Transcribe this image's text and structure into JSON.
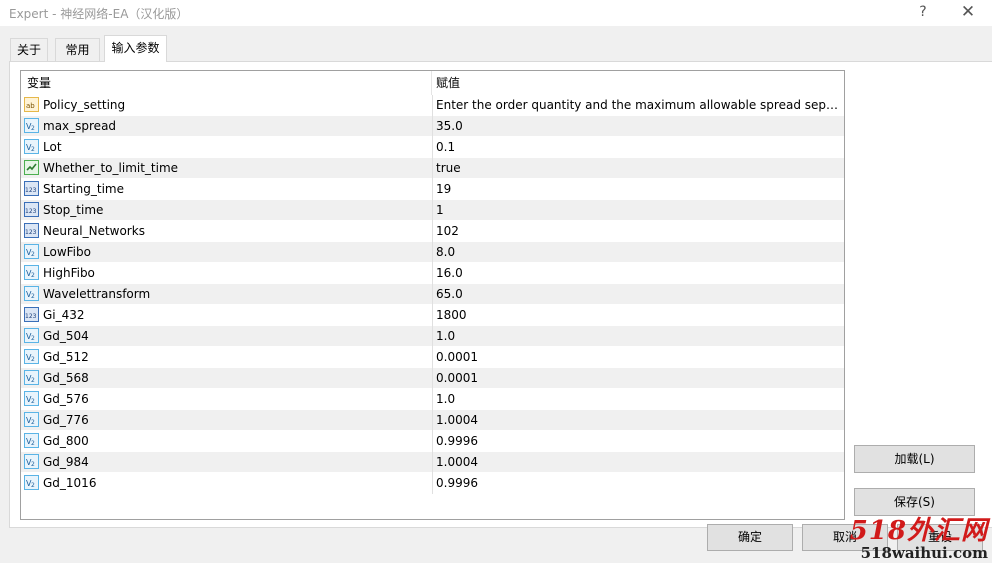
{
  "window": {
    "title": "Expert - 神经网络-EA（汉化版）",
    "help_label": "?",
    "close_label": "✕"
  },
  "tabs": [
    {
      "label": "关于"
    },
    {
      "label": "常用"
    },
    {
      "label": "输入参数"
    }
  ],
  "grid": {
    "header_variable": "变量",
    "header_value": "赋值",
    "rows": [
      {
        "icon": "text",
        "name": "Policy_setting",
        "value": "Enter the order quantity and the maximum allowable spread separa…"
      },
      {
        "icon": "double",
        "name": "max_spread",
        "value": "35.0"
      },
      {
        "icon": "double",
        "name": "Lot",
        "value": "0.1"
      },
      {
        "icon": "bool",
        "name": "Whether_to_limit_time",
        "value": "true"
      },
      {
        "icon": "int",
        "name": "Starting_time",
        "value": "19"
      },
      {
        "icon": "int",
        "name": "Stop_time",
        "value": "1"
      },
      {
        "icon": "int",
        "name": "Neural_Networks",
        "value": "102"
      },
      {
        "icon": "double",
        "name": "LowFibo",
        "value": "8.0"
      },
      {
        "icon": "double",
        "name": "HighFibo",
        "value": "16.0"
      },
      {
        "icon": "double",
        "name": "Wavelettransform",
        "value": "65.0"
      },
      {
        "icon": "int",
        "name": "Gi_432",
        "value": "1800"
      },
      {
        "icon": "double",
        "name": "Gd_504",
        "value": "1.0"
      },
      {
        "icon": "double",
        "name": "Gd_512",
        "value": "0.0001"
      },
      {
        "icon": "double",
        "name": "Gd_568",
        "value": "0.0001"
      },
      {
        "icon": "double",
        "name": "Gd_576",
        "value": "1.0"
      },
      {
        "icon": "double",
        "name": "Gd_776",
        "value": "1.0004"
      },
      {
        "icon": "double",
        "name": "Gd_800",
        "value": "0.9996"
      },
      {
        "icon": "double",
        "name": "Gd_984",
        "value": "1.0004"
      },
      {
        "icon": "double",
        "name": "Gd_1016",
        "value": "0.9996"
      }
    ]
  },
  "buttons": {
    "load": "加载(L)",
    "save": "保存(S)",
    "ok": "确定",
    "cancel": "取消",
    "reset": "重设"
  },
  "watermark": {
    "main": "518外汇网",
    "sub": "518waihui.com"
  },
  "icon_colors": {
    "double_bg": "#5ab4e6",
    "int_bg": "#3a6fb8",
    "bool_bg": "#4caf50",
    "text_bg": "#e6b84a"
  }
}
